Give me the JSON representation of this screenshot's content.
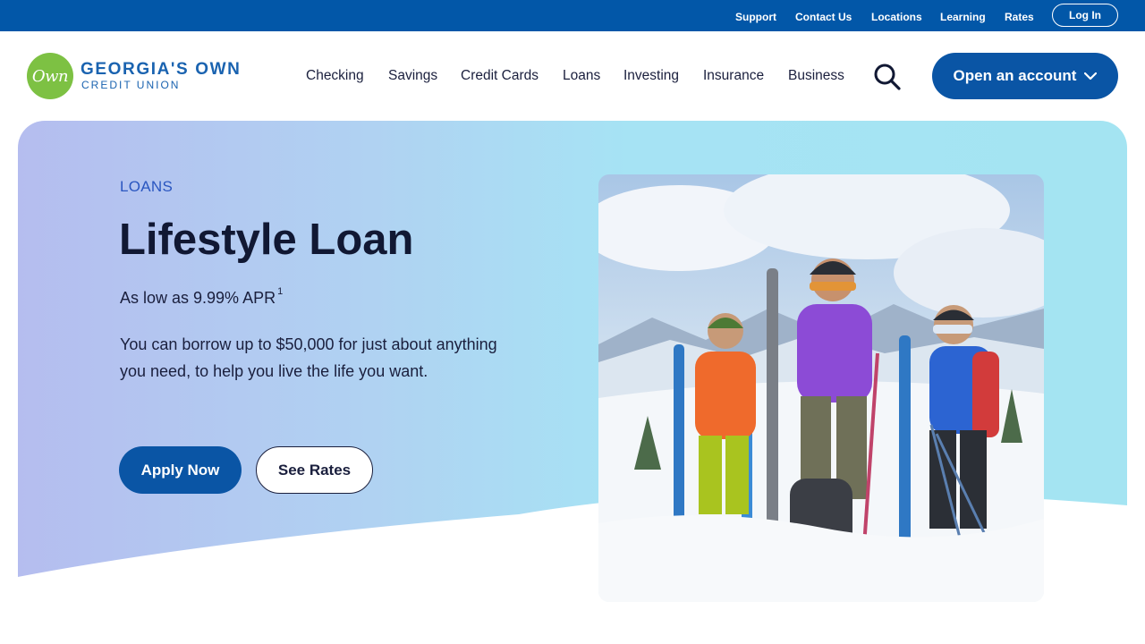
{
  "utility": {
    "links": [
      "Support",
      "Contact Us",
      "Locations",
      "Learning",
      "Rates"
    ],
    "login_label": "Log In"
  },
  "brand": {
    "badge_text": "Own",
    "name_line1": "GEORGIA'S OWN",
    "name_line2": "CREDIT UNION",
    "color_primary": "#0a55a5",
    "color_green": "#7dc143"
  },
  "nav": {
    "items": [
      "Checking",
      "Savings",
      "Credit Cards",
      "Loans",
      "Investing",
      "Insurance",
      "Business"
    ],
    "search_icon": "search-icon",
    "cta_label": "Open an account"
  },
  "hero": {
    "eyebrow": "LOANS",
    "title": "Lifestyle Loan",
    "rate_text": "As low as 9.99% APR",
    "rate_footnote": "1",
    "body": "You can borrow up to $50,000 for just about anything you need, to help you live the life you want.",
    "apply_label": "Apply Now",
    "rates_label": "See Rates"
  }
}
